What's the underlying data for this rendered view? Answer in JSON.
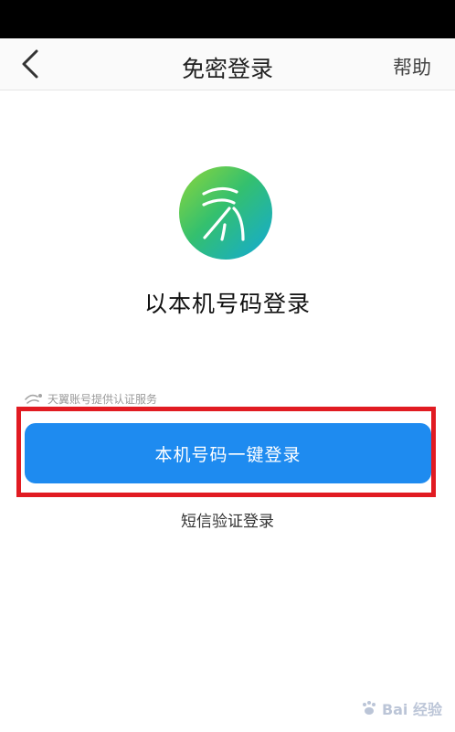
{
  "nav": {
    "back_icon": "chevron-left-icon",
    "title": "免密登录",
    "help_label": "帮助"
  },
  "logo": {
    "icon": "tianyi-logo"
  },
  "hero": {
    "title": "以本机号码登录"
  },
  "provider": {
    "icon": "tianyi-mini-icon",
    "text": "天翼账号提供认证服务"
  },
  "primary_button": {
    "label": "本机号码一键登录",
    "color": "#1e8bf0"
  },
  "secondary_link": {
    "label": "短信验证登录"
  },
  "annotation": {
    "color": "#e11b22"
  },
  "watermark": {
    "text": "Bai 经验"
  }
}
